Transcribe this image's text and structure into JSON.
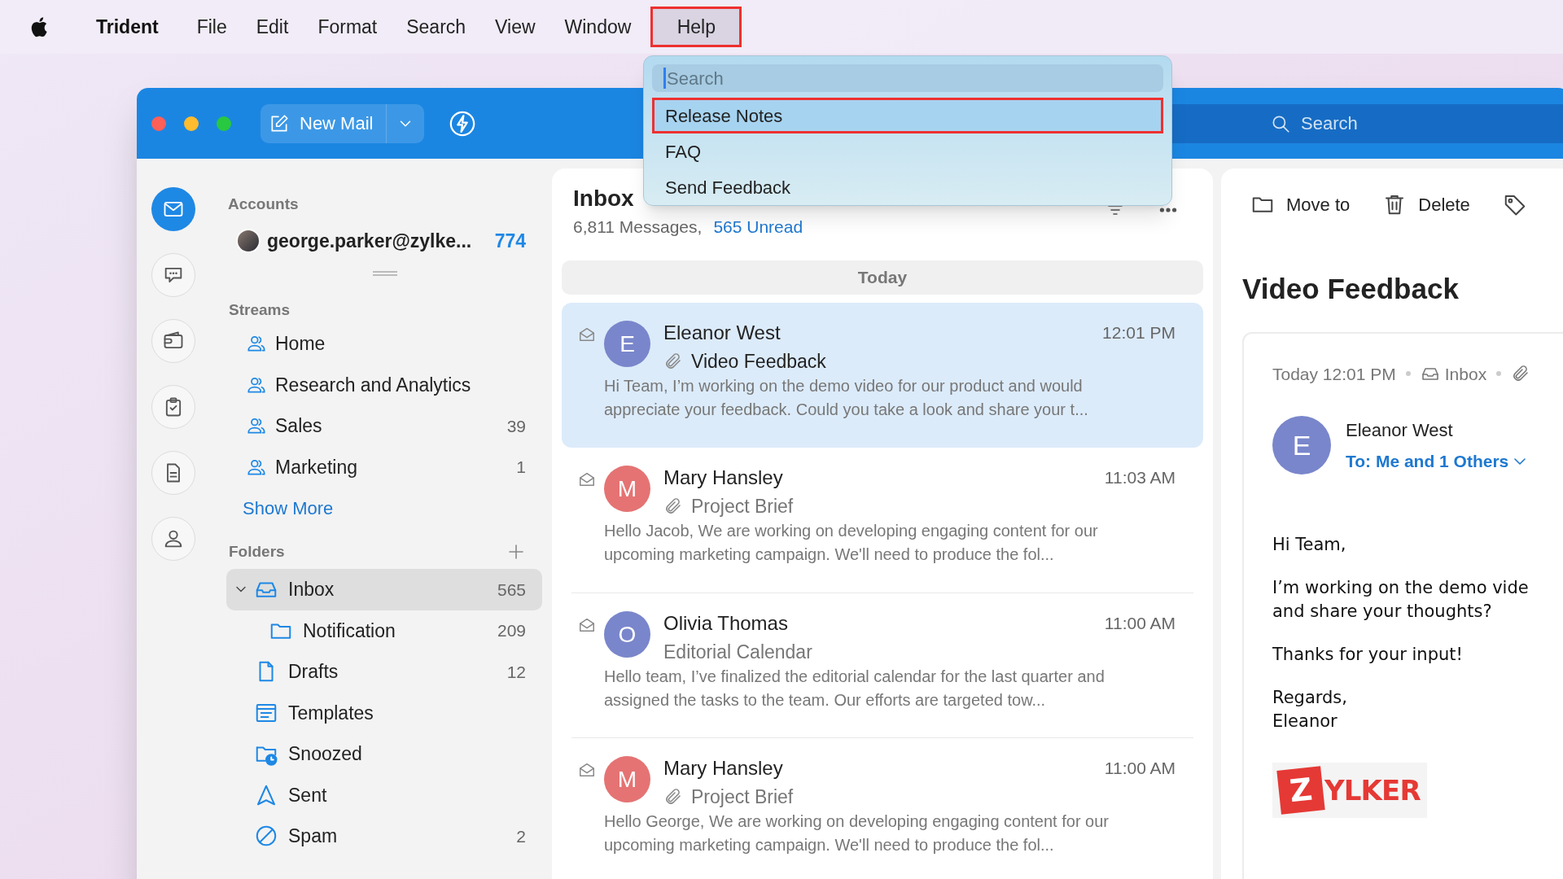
{
  "menu_bar": {
    "items": [
      {
        "label": "Trident",
        "kind": "app",
        "highlighted": false
      },
      {
        "label": "File",
        "kind": "menu",
        "highlighted": false
      },
      {
        "label": "Edit",
        "kind": "menu",
        "highlighted": false
      },
      {
        "label": "Format",
        "kind": "menu",
        "highlighted": false
      },
      {
        "label": "Search",
        "kind": "menu",
        "highlighted": false
      },
      {
        "label": "View",
        "kind": "menu",
        "highlighted": false
      },
      {
        "label": "Window",
        "kind": "menu",
        "highlighted": false
      },
      {
        "label": "Help",
        "kind": "menu",
        "highlighted": true
      }
    ]
  },
  "help_menu": {
    "search": {
      "placeholder": "Search"
    },
    "items": [
      {
        "label": "Release Notes",
        "highlighted": true
      },
      {
        "label": "FAQ",
        "highlighted": false
      },
      {
        "label": "Send Feedback",
        "highlighted": false
      }
    ]
  },
  "toolbar": {
    "new_mail": "New Mail",
    "search": {
      "placeholder": "Search"
    }
  },
  "rail": {
    "items": [
      {
        "selected": true
      },
      {
        "selected": false
      },
      {
        "selected": false
      },
      {
        "selected": false
      },
      {
        "selected": false
      },
      {
        "selected": false
      }
    ]
  },
  "sidebar": {
    "accounts": {
      "label": "Accounts",
      "items": [
        {
          "name": "george.parker@zylke...",
          "count": "774"
        }
      ]
    },
    "streams": {
      "label": "Streams",
      "items": [
        {
          "name": "Home"
        },
        {
          "name": "Research and Analytics"
        },
        {
          "name": "Sales",
          "count": "39"
        },
        {
          "name": "Marketing",
          "count": "1"
        }
      ],
      "show_more": "Show More"
    },
    "folders": {
      "label": "Folders",
      "items": [
        {
          "name": "Inbox",
          "count": "565",
          "selected": true,
          "expanded": true,
          "children": [
            {
              "name": "Notification",
              "count": "209",
              "selected": false
            }
          ]
        },
        {
          "name": "Drafts",
          "count": "12",
          "selected": false
        },
        {
          "name": "Templates",
          "selected": false
        },
        {
          "name": "Snoozed",
          "selected": false
        },
        {
          "name": "Sent",
          "selected": false
        },
        {
          "name": "Spam",
          "count": "2",
          "selected": false
        }
      ]
    }
  },
  "message_list": {
    "title": "Inbox",
    "total": "6,811 Messages,",
    "unread": "565 Unread",
    "group": "Today",
    "messages": [
      {
        "sender": "Eleanor West",
        "initial": "E",
        "color": "#7986cb",
        "time": "12:01 PM",
        "subject": "Video Feedback",
        "attachment": true,
        "selected": true,
        "preview": "Hi Team, I’m working on the demo video for our product and would appreciate your feedback. Could you take a look and share your t..."
      },
      {
        "sender": "Mary Hansley",
        "initial": "M",
        "color": "#e57373",
        "time": "11:03 AM",
        "subject": "Project Brief",
        "attachment": true,
        "selected": false,
        "preview": "Hello Jacob, We are working on developing engaging content for our upcoming marketing campaign. We'll need to produce the fol..."
      },
      {
        "sender": "Olivia Thomas",
        "initial": "O",
        "color": "#7986cb",
        "time": "11:00 AM",
        "subject": "Editorial Calendar",
        "attachment": false,
        "selected": false,
        "preview": "Hello team, I’ve finalized the editorial calendar for the last quarter and assigned the tasks to the team. Our efforts are targeted tow..."
      },
      {
        "sender": "Mary Hansley",
        "initial": "M",
        "color": "#e57373",
        "time": "11:00 AM",
        "subject": "Project Brief",
        "attachment": true,
        "selected": false,
        "preview": "Hello George, We are working on developing engaging content for our upcoming marketing campaign. We'll need to produce the fol..."
      }
    ]
  },
  "reading_pane": {
    "actions": [
      {
        "label": "Move to"
      },
      {
        "label": "Delete"
      }
    ],
    "subject": "Video Feedback",
    "meta": {
      "date": "Today 12:01 PM",
      "folder": "Inbox"
    },
    "sender": {
      "initial": "E",
      "color": "#7986cb",
      "name": "Eleanor West",
      "recipients": "To: Me and 1 Others"
    },
    "body": [
      [
        "Hi Team,"
      ],
      [
        "I’m working on the demo vide",
        "and share your thoughts?"
      ],
      [
        "Thanks for your input!"
      ],
      [
        "Regards,",
        "Eleanor"
      ]
    ],
    "logo": {
      "mark": "Z",
      "text": "YLKER"
    }
  }
}
